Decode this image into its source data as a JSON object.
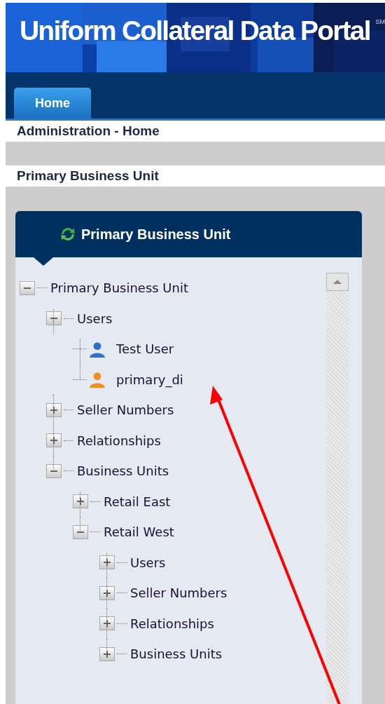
{
  "header": {
    "title": "Uniform Collateral Data Portal",
    "mark": "SM"
  },
  "tabs": [
    {
      "label": "Home",
      "selected": true
    }
  ],
  "breadcrumb": "Administration - Home",
  "section_title": "Primary Business Unit",
  "panel": {
    "title": "Primary Business Unit"
  },
  "tree": {
    "items": [
      {
        "label": "Primary Business Unit",
        "kind": "folder",
        "expanded": true,
        "children": [
          {
            "label": "Users",
            "kind": "folder",
            "expanded": true,
            "children": [
              {
                "label": "Test User",
                "kind": "user",
                "color": "#2f73c8"
              },
              {
                "label": "primary_di",
                "kind": "user",
                "color": "#f0901e"
              }
            ]
          },
          {
            "label": "Seller Numbers",
            "kind": "folder",
            "expanded": false
          },
          {
            "label": "Relationships",
            "kind": "folder",
            "expanded": false
          },
          {
            "label": "Business Units",
            "kind": "folder",
            "expanded": true,
            "children": [
              {
                "label": "Retail East",
                "kind": "folder",
                "expanded": false
              },
              {
                "label": "Retail West",
                "kind": "folder",
                "expanded": true,
                "children": [
                  {
                    "label": "Users",
                    "kind": "folder",
                    "expanded": false
                  },
                  {
                    "label": "Seller Numbers",
                    "kind": "folder",
                    "expanded": false
                  },
                  {
                    "label": "Relationships",
                    "kind": "folder",
                    "expanded": false
                  },
                  {
                    "label": "Business Units",
                    "kind": "folder",
                    "expanded": false
                  }
                ]
              }
            ]
          }
        ]
      }
    ]
  }
}
